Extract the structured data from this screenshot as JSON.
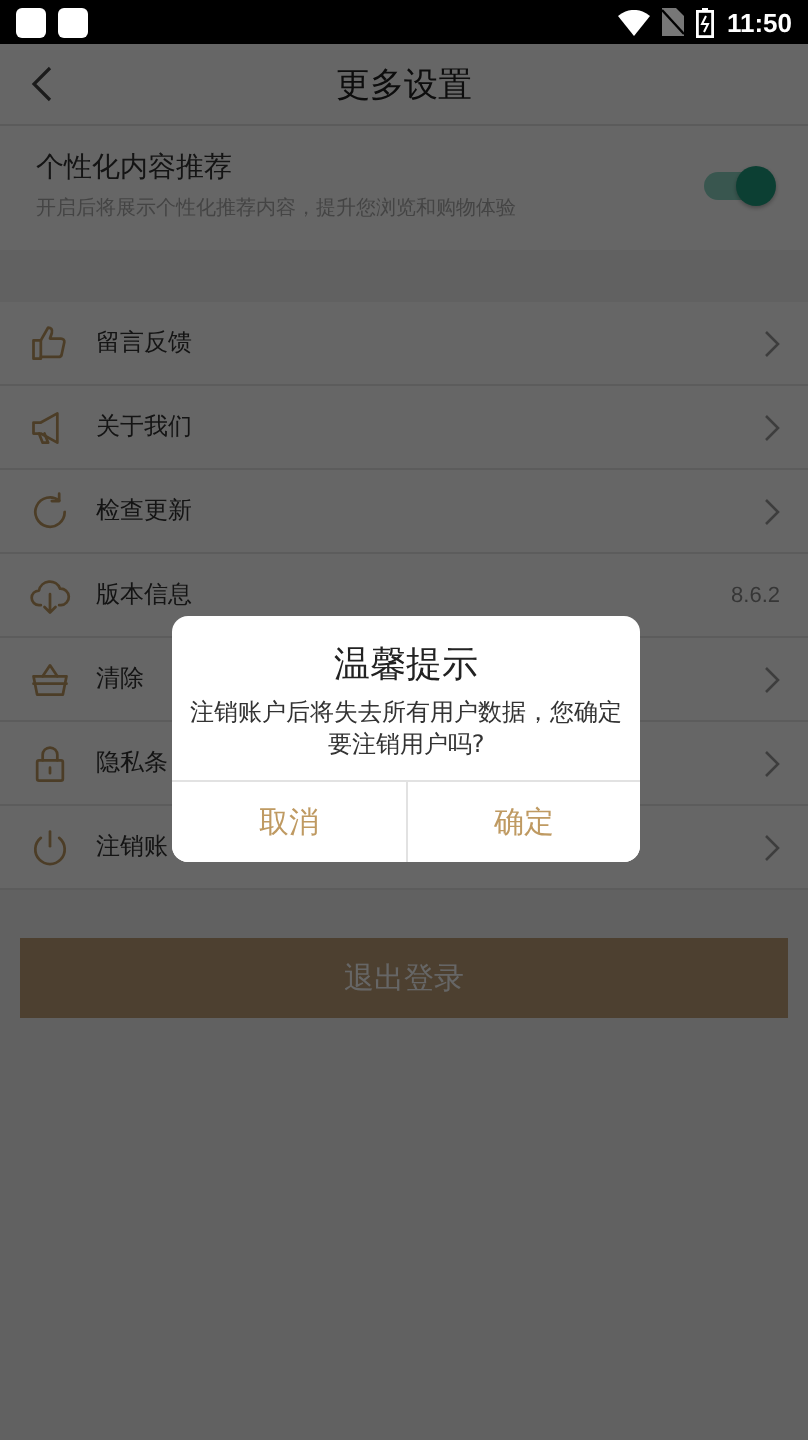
{
  "status_bar": {
    "time": "11:50"
  },
  "header": {
    "title": "更多设置"
  },
  "personalized": {
    "label": "个性化内容推荐",
    "description": "开启后将展示个性化推荐内容，提升您浏览和购物体验",
    "on": true
  },
  "menu": [
    {
      "kind": "link",
      "label": "留言反馈"
    },
    {
      "kind": "link",
      "label": "关于我们"
    },
    {
      "kind": "link",
      "label": "检查更新"
    },
    {
      "kind": "value",
      "label": "版本信息",
      "value": "8.6.2"
    },
    {
      "kind": "link",
      "label": "清除"
    },
    {
      "kind": "link",
      "label": "隐私条"
    },
    {
      "kind": "link",
      "label": "注销账"
    }
  ],
  "logout_button": "退出登录",
  "dialog": {
    "title": "温馨提示",
    "message": "注销账户后将失去所有用户数据，您确定要注销用户吗?",
    "buttons": [
      "取消",
      "确定"
    ]
  }
}
